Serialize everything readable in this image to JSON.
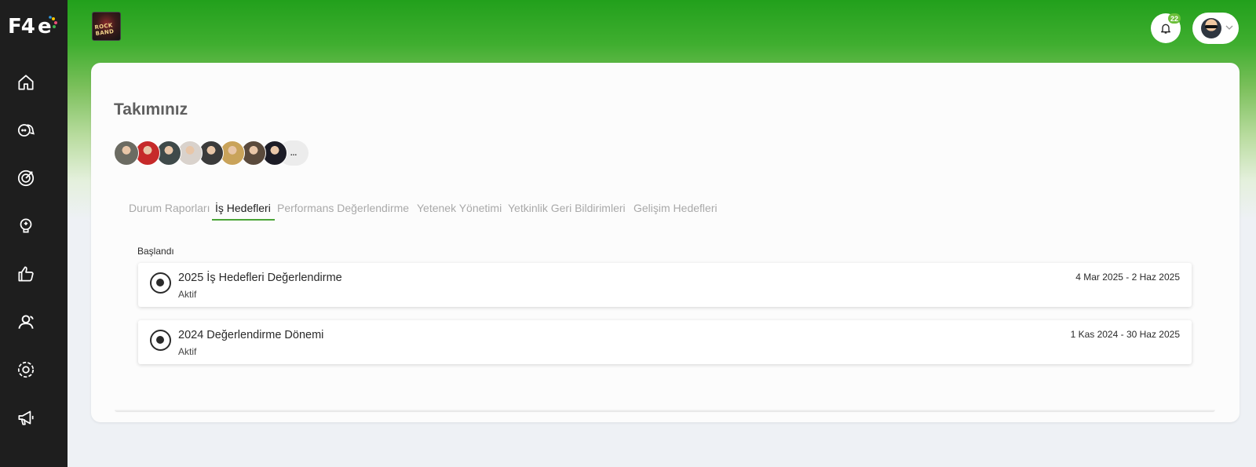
{
  "brand": {
    "logo_text": "F4e",
    "thumbnail_text": "ROCK BAND"
  },
  "sidebar": {
    "items": [
      {
        "icon": "home-icon"
      },
      {
        "icon": "chat-icon"
      },
      {
        "icon": "target-icon"
      },
      {
        "icon": "idea-icon"
      },
      {
        "icon": "thumbs-up-icon"
      },
      {
        "icon": "team-icon"
      },
      {
        "icon": "settings-icon"
      },
      {
        "icon": "megaphone-icon"
      }
    ]
  },
  "header": {
    "notifications_count": "22",
    "accent_color": "#22a01c"
  },
  "page": {
    "title": "Takımınız"
  },
  "team": {
    "avatar_colors": [
      "#6b6b62",
      "#c62a2a",
      "#3f4a4a",
      "#d9d2cc",
      "#3b3b3b",
      "#c9a35a",
      "#5a4a3c",
      "#1c1c26"
    ],
    "more_label": "..."
  },
  "tabs": [
    {
      "label": "Durum Raporları",
      "active": false
    },
    {
      "label": "İş Hedefleri",
      "active": true
    },
    {
      "label": "Performans Değerlendirme",
      "active": false
    },
    {
      "label": "Yetenek Yönetimi",
      "active": false
    },
    {
      "label": "Yetkinlik Geri Bildirimleri",
      "active": false
    },
    {
      "label": "Gelişim Hedefleri",
      "active": false
    }
  ],
  "section": {
    "label": "Başlandı",
    "items": [
      {
        "title": "2025 İş Hedefleri Değerlendirme",
        "status": "Aktif",
        "dates": "4 Mar 2025 - 2 Haz 2025"
      },
      {
        "title": "2024 Değerlendirme Dönemi",
        "status": "Aktif",
        "dates": "1 Kas 2024 - 30 Haz 2025"
      }
    ]
  }
}
